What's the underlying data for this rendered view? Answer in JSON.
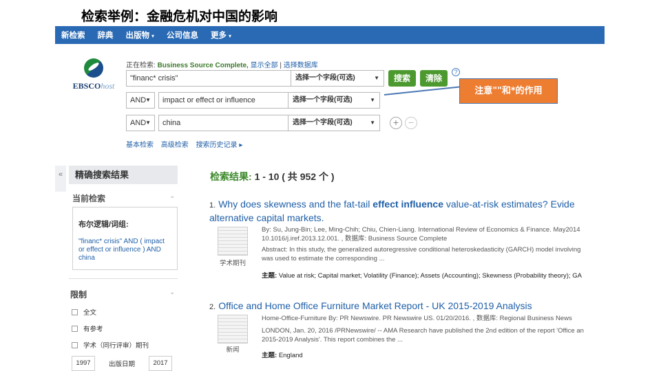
{
  "slide": {
    "title": "检索举例：金融危机对中国的影响"
  },
  "topnav": [
    {
      "label": "新检索"
    },
    {
      "label": "辞典"
    },
    {
      "label": "出版物",
      "caret": "▾"
    },
    {
      "label": "公司信息"
    },
    {
      "label": "更多",
      "caret": "▾"
    }
  ],
  "logo": {
    "ebsco": "EBSCO",
    "host": "host"
  },
  "search": {
    "searching_prefix": "正在检索:",
    "database": "Business Source Complete,",
    "show_all": "显示全部",
    "separator": "|",
    "choose_db": "选择数据库",
    "rows": [
      {
        "bool": "",
        "term": "\"financ* crisis\"",
        "field": "选择一个字段(可选)"
      },
      {
        "bool": "AND",
        "term": "impact or effect or influence",
        "field": "选择一个字段(可选)"
      },
      {
        "bool": "AND",
        "term": "china",
        "field": "选择一个字段(可选)"
      }
    ],
    "search_btn": "搜索",
    "clear_btn": "清除",
    "help": "?",
    "plus": "+",
    "minus": "−",
    "links": [
      "基本检索",
      "高级检索",
      "搜索历史记录 ▸"
    ]
  },
  "callout": {
    "text": "注意\"\"和*的作用"
  },
  "sidebar": {
    "collapse": "«",
    "heading": "精确搜索结果",
    "current_search": "当前检索",
    "boolean_label": "布尔逻辑/词组:",
    "query": "\"financ* crisis\" AND ( impact or effect or influence ) AND china",
    "limit": "限制",
    "checks": [
      "全文",
      "有参考",
      "学术（同行评审）期刊"
    ],
    "date_from": "1997",
    "date_label": "出版日期",
    "date_to": "2017"
  },
  "results": {
    "label": "检索结果:",
    "range": "1 - 10 ( 共 952 个 )",
    "items": [
      {
        "num": "1.",
        "title_a": "Why does skewness and the fat-tail ",
        "title_b": "effect influence",
        "title_c": " value-at-risk estimates? Evide",
        "title_line2": "alternative capital markets.",
        "type": "学术期刊",
        "meta1": "By: Su, Jung-Bin; Lee, Ming-Chih; Chiu, Chien-Liang. International Review of Economics & Finance. May2014",
        "meta1b": "10.1016/j.iref.2013.12.001. , 数据库: Business Source Complete",
        "meta2": "Abstract: In this study, the generalized autoregressive conditional heteroskedasticity (GARCH) model involving",
        "meta2b": "was used to estimate the corresponding ...",
        "subj_label": "主题:",
        "subjects": "Value at risk; Capital market; Volatility (Finance); Assets (Accounting); Skewness (Probability theory); GA"
      },
      {
        "num": "2.",
        "title": "Office and Home Office Furniture Market Report - UK 2015-2019 Analysis",
        "type": "新闻",
        "meta1": "Home-Office-Furniture By: PR Newswire. PR Newswire US. 01/20/2016. , 数据库: Regional Business News",
        "meta2": "LONDON, Jan. 20, 2016 /PRNewswire/ -- AMA Research have published the 2nd edition of the report 'Office an",
        "meta2b": "2015-2019 Analysis'. This report combines the ...",
        "subj_label": "主题:",
        "subjects": "England"
      }
    ]
  }
}
